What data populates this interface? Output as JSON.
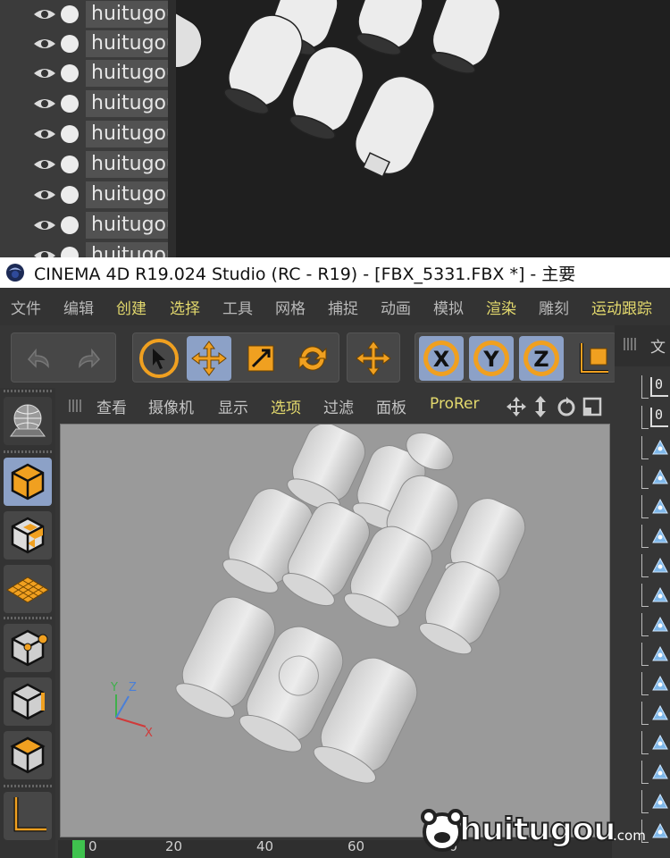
{
  "top_panel": {
    "object_names": [
      "huitugou",
      "huitugou",
      "huitugou",
      "huitugou",
      "huitugou",
      "huitugou",
      "huitugou",
      "huitugou",
      "huitugou"
    ]
  },
  "window": {
    "title": "CINEMA 4D R19.024 Studio (RC - R19) - [FBX_5331.FBX *] - 主要"
  },
  "menubar": {
    "items": [
      {
        "label": "文件"
      },
      {
        "label": "编辑"
      },
      {
        "label": "创建"
      },
      {
        "label": "选择"
      },
      {
        "label": "工具"
      },
      {
        "label": "网格"
      },
      {
        "label": "捕捉"
      },
      {
        "label": "动画"
      },
      {
        "label": "模拟"
      },
      {
        "label": "渲染"
      },
      {
        "label": "雕刻"
      },
      {
        "label": "运动跟踪"
      }
    ]
  },
  "toolbar": {
    "undo_icon": "undo-icon",
    "redo_icon": "redo-icon",
    "axis_x": "X",
    "axis_y": "Y",
    "axis_z": "Z"
  },
  "viewport_menu": {
    "items": [
      {
        "label": "查看"
      },
      {
        "label": "摄像机"
      },
      {
        "label": "显示"
      },
      {
        "label": "选项"
      },
      {
        "label": "过滤"
      },
      {
        "label": "面板"
      },
      {
        "label": "ProRer"
      }
    ]
  },
  "axis_gizmo": {
    "x": "X",
    "y": "Y",
    "z": "Z"
  },
  "timeline": {
    "ticks": [
      "0",
      "20",
      "40",
      "60",
      "80"
    ]
  },
  "right_panel": {
    "header": "文",
    "null_label": "0"
  },
  "watermark": {
    "text": "huitugou",
    "suffix": ".com"
  },
  "colors": {
    "accent_orange": "#f0a020",
    "active_blue": "#8ca1c7",
    "menu_highlight": "#e3d96d"
  }
}
